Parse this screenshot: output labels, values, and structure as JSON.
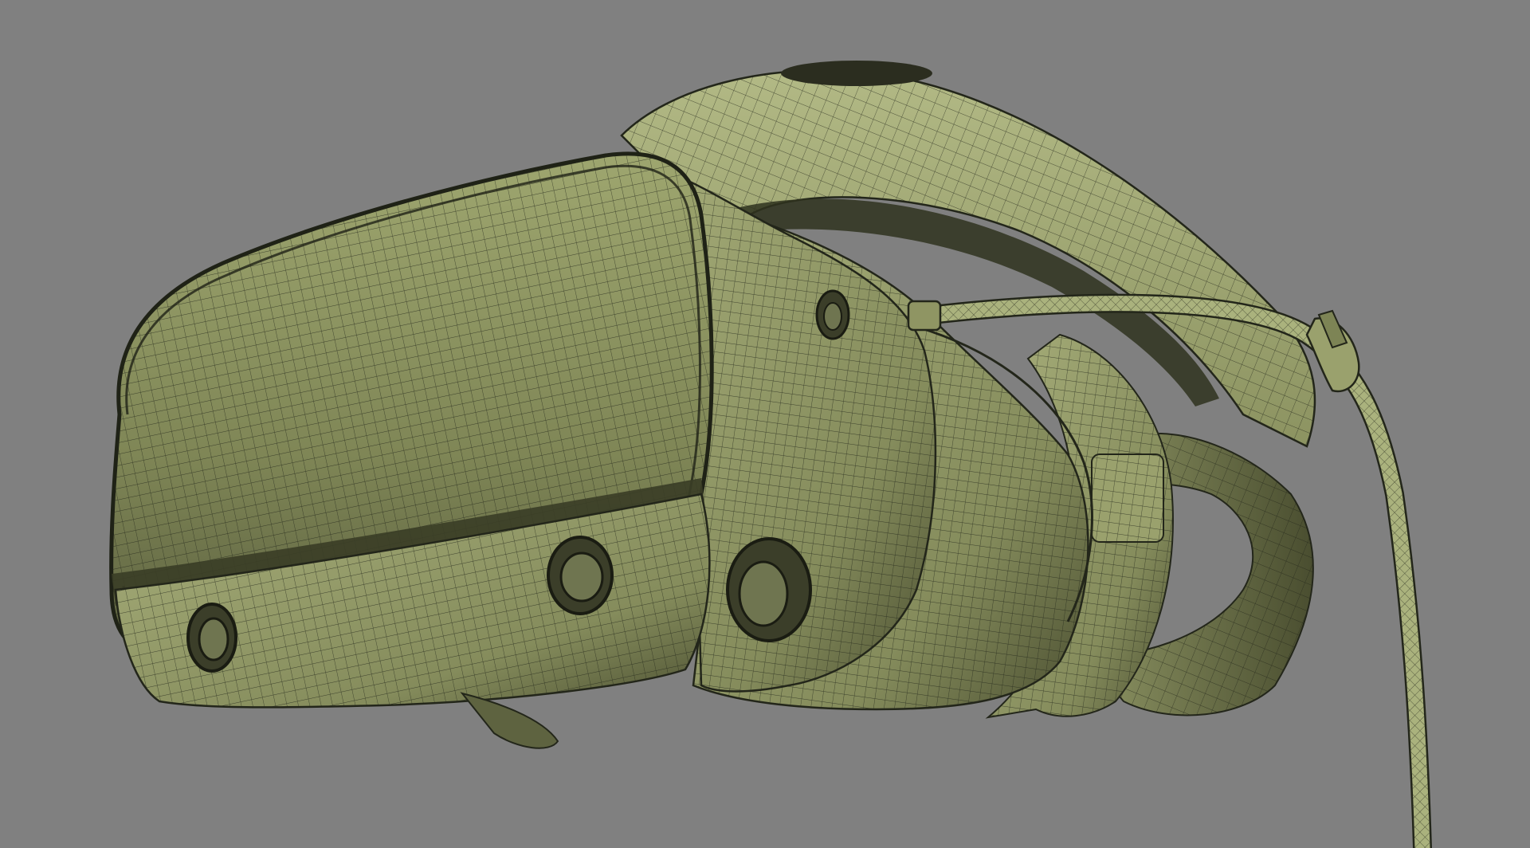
{
  "scene": {
    "background_color": "#808080",
    "subject": "vr-headset-wireframe-render",
    "palette": {
      "mesh_fill_light": "#a9b07c",
      "mesh_fill_mid": "#8f9563",
      "mesh_fill_dark": "#4e5233",
      "mesh_line": "#23261a",
      "shadow": "#2b2d1f",
      "background": "#808080"
    }
  },
  "icons": {
    "headband": "headband-strap-mesh",
    "visor": "front-visor-mesh",
    "cameras": "tracking-camera-lens",
    "cable": "tether-cable-mesh"
  }
}
